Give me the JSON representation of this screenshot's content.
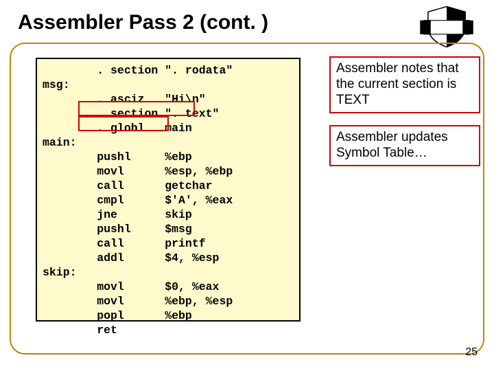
{
  "title": "Assembler Pass 2 (cont. )",
  "code": {
    "l1": "        . section \". rodata\"",
    "l2": "msg:",
    "l3": "        . asciz   \"Hi\\n\"",
    "l4": "        . section \". text\"",
    "l5": "        . globl   main",
    "l6": "main:",
    "l7": "        pushl     %ebp",
    "l8": "        movl      %esp, %ebp",
    "l9": "        call      getchar",
    "l10": "        cmpl      $'A', %eax",
    "l11": "        jne       skip",
    "l12": "        pushl     $msg",
    "l13": "        call      printf",
    "l14": "        addl      $4, %esp",
    "l15": "skip:",
    "l16": "        movl      $0, %eax",
    "l17": "        movl      %ebp, %esp",
    "l18": "        popl      %ebp",
    "l19": "        ret"
  },
  "note1": "Assembler notes that the current section is TEXT",
  "note2": "Assembler updates Symbol Table…",
  "pagenum": "25"
}
